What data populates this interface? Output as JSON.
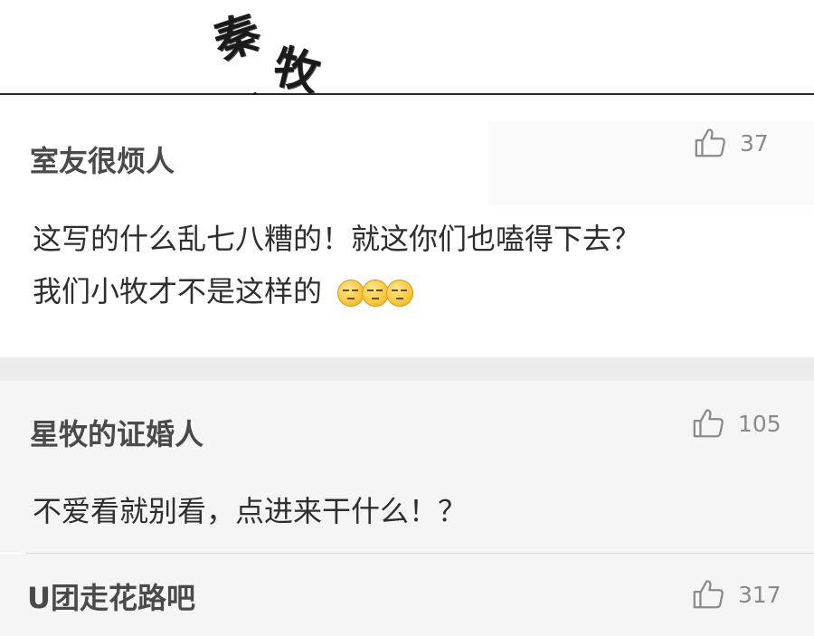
{
  "annotation": {
    "handwritten_chars": [
      "秦",
      "牧"
    ]
  },
  "comments": [
    {
      "username": "室友很烦人",
      "likes": "37",
      "lines": [
        "这写的什么乱七八糟的！就这你们也嗑得下去？",
        "我们小牧才不是这样的"
      ],
      "emoji_icons": [
        "grimace-emoji-icon",
        "grimace-emoji-icon",
        "grimace-emoji-icon"
      ]
    },
    {
      "username": "星牧的证婚人",
      "likes": "105",
      "lines": [
        "不爱看就别看，点进来干什么！？"
      ]
    },
    {
      "username": "U团走花路吧",
      "likes": "317"
    }
  ],
  "icons": {
    "like": "thumbs-up-outline-icon",
    "arrow": "down-left-arrow-icon"
  },
  "colors": {
    "background": "#ffffff",
    "reply_background": "#f5f5f5",
    "separator_band": "#ebebeb",
    "username_text": "#4a4a4a",
    "like_text": "#8a8a8a"
  }
}
